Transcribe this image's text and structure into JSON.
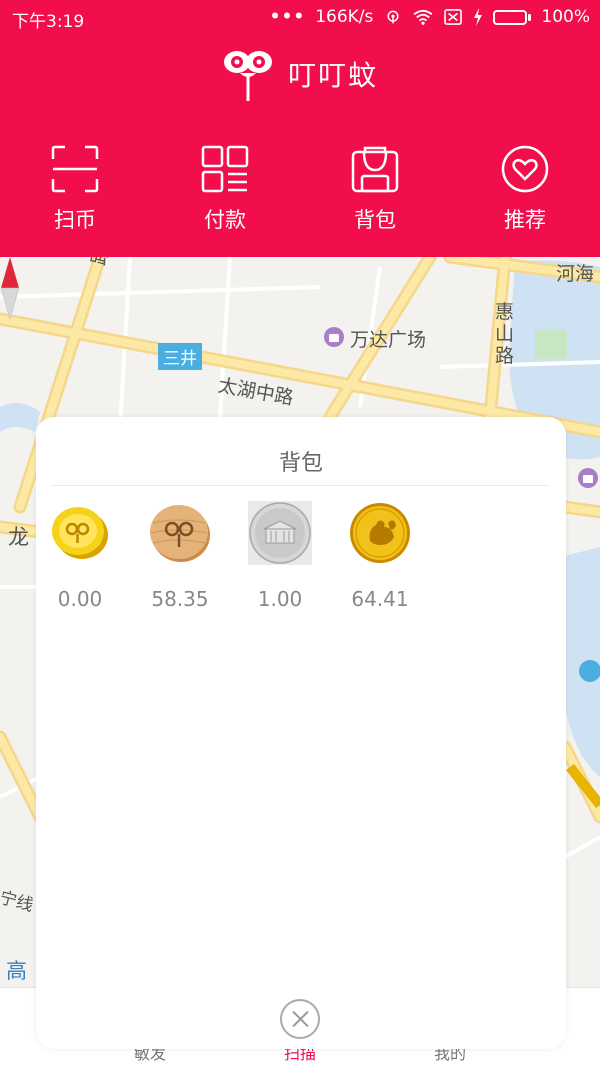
{
  "status_bar": {
    "time": "下午3:19",
    "dots": "•••",
    "network_speed": "166K/s",
    "battery": "100%",
    "battery_level": 1.0
  },
  "header": {
    "app_name": "叮叮蚊",
    "logo_icon": "mosquito-logo-icon"
  },
  "actions": [
    {
      "label": "扫币",
      "icon": "scan-frame-icon"
    },
    {
      "label": "付款",
      "icon": "qr-code-icon"
    },
    {
      "label": "背包",
      "icon": "backpack-icon"
    },
    {
      "label": "推荐",
      "icon": "heart-circle-icon"
    }
  ],
  "map": {
    "labels": {
      "road_top": "路",
      "road_tr": "河海",
      "road_taihu": "太湖中路",
      "road_huishan": "惠山路",
      "mall": "万达广场",
      "metro": "三井",
      "road_long": "龙",
      "road_ning": "宁线",
      "road_gao": "高"
    }
  },
  "tabbar": {
    "items": [
      "敏发",
      "扫描",
      "我的"
    ],
    "active_index": 1
  },
  "backpack": {
    "title": "背包",
    "coins": [
      {
        "value": "0.00",
        "icon": "gold-coin-icon"
      },
      {
        "value": "58.35",
        "icon": "wooden-coin-icon"
      },
      {
        "value": "1.00",
        "icon": "silver-coin-icon"
      },
      {
        "value": "64.41",
        "icon": "rooster-gold-coin-icon"
      }
    ]
  },
  "colors": {
    "brand_red": "#f20d4b",
    "map_bg": "#f3f2ee",
    "road_yellow": "#fce9a5",
    "water_blue": "#cfe2f3"
  }
}
